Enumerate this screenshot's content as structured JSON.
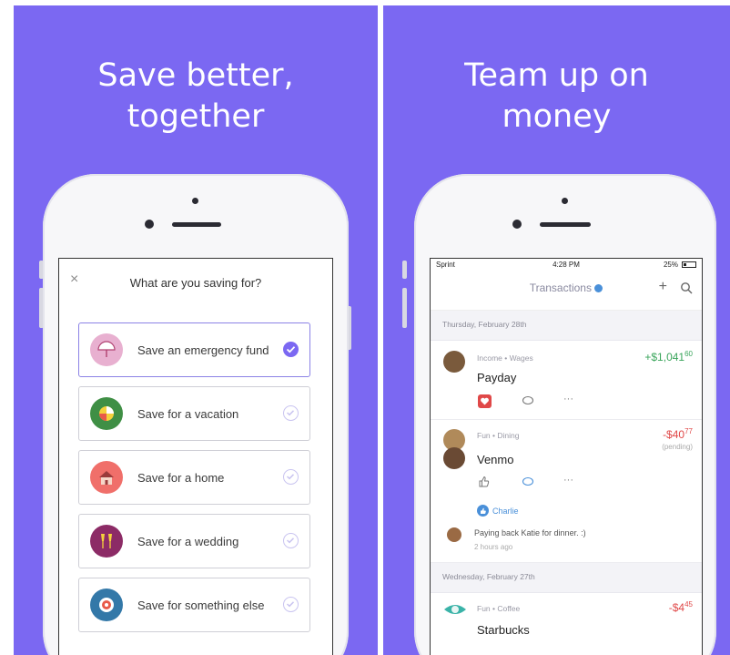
{
  "left": {
    "headline": [
      "Save better,",
      "together"
    ],
    "close": "×",
    "question": "What are you saving for?",
    "goals": [
      {
        "label": "Save an emergency fund",
        "icon": "umbrella-icon",
        "color": "#e8b0d0",
        "selected": true
      },
      {
        "label": "Save for a vacation",
        "icon": "beach-ball-icon",
        "color": "#3f8f45",
        "selected": false
      },
      {
        "label": "Save for a home",
        "icon": "house-icon",
        "color": "#f06f6a",
        "selected": false
      },
      {
        "label": "Save for a wedding",
        "icon": "champagne-icon",
        "color": "#8c2b66",
        "selected": false
      },
      {
        "label": "Save for something else",
        "icon": "target-icon",
        "color": "#3378a8",
        "selected": false
      }
    ]
  },
  "right": {
    "headline": [
      "Team up on",
      "money"
    ],
    "status": {
      "carrier": "Sprint",
      "time": "4:28 PM",
      "battery": "25%"
    },
    "nav_title": "Transactions",
    "dates": [
      "Thursday, February 28th",
      "Wednesday, February 27th"
    ],
    "transactions": [
      {
        "category": "Income • Wages",
        "name": "Payday",
        "amount_main": "+$1,041",
        "amount_cents": "60",
        "sign": "pos"
      },
      {
        "category": "Fun • Dining",
        "name": "Venmo",
        "amount_main": "-$40",
        "amount_cents": "77",
        "sign": "neg",
        "note": "(pending)"
      },
      {
        "category": "Fun • Coffee",
        "name": "Starbucks",
        "amount_main": "-$4",
        "amount_cents": "45",
        "sign": "neg"
      }
    ],
    "like_by": "Charlie",
    "comment": {
      "text": "Paying back Katie for dinner. :)",
      "time": "2 hours ago"
    },
    "more": "···"
  },
  "colors": {
    "background": "#7b68f2",
    "accent": "#7b68f2",
    "positive": "#3aa55b",
    "negative": "#e04848"
  }
}
